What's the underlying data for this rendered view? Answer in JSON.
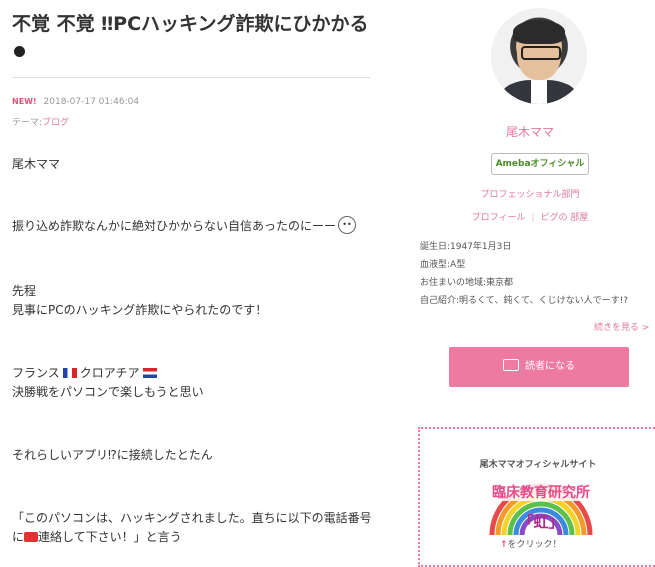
{
  "article": {
    "title": "不覚 不覚 ‼PCハッキング詐欺にひかかる",
    "new_label": "NEW!",
    "datetime": "2018-07-17 01:46:04",
    "theme_label": "テーマ:",
    "theme_value": "ブログ",
    "lines": [
      "尾木ママ",
      "振り込め詐欺なんかに絶対ひかからない自信あったのにーー",
      "先程",
      "見事にPCのハッキング詐欺にやられたのです！",
      "フランス",
      "クロアチア",
      "決勝戦をパソコンで楽しもうと思い",
      "それらしいアプリ⁉に接続したとたん",
      "「このパソコンは、ハッキングされました。直ちに以下の電話番号",
      "に",
      "連絡して下さい！」と言う"
    ]
  },
  "profile": {
    "name": "尾木ママ",
    "official_badge": "Amebaオフィシャル",
    "professional": "プロフェッショナル部門",
    "profile_link": "プロフィール",
    "room_link": "ピグの 部屋",
    "birthday": "誕生日:1947年1月3日",
    "blood": "血液型:A型",
    "location": "お住まいの地域:東京都",
    "intro": "自己紹介:明るくて、鈍くて、くじけない人でーす!?",
    "more": "続きを見る >",
    "reader_button": "読者になる"
  },
  "banner": {
    "title": "尾木ママオフィシャルサイト",
    "image_text": "臨床教育研究所",
    "image_sub": "「虹」",
    "click": "をクリック！"
  },
  "colors": {
    "accent": "#ee7aa1",
    "link": "#e0799e",
    "official_green": "#4a8a2a"
  }
}
